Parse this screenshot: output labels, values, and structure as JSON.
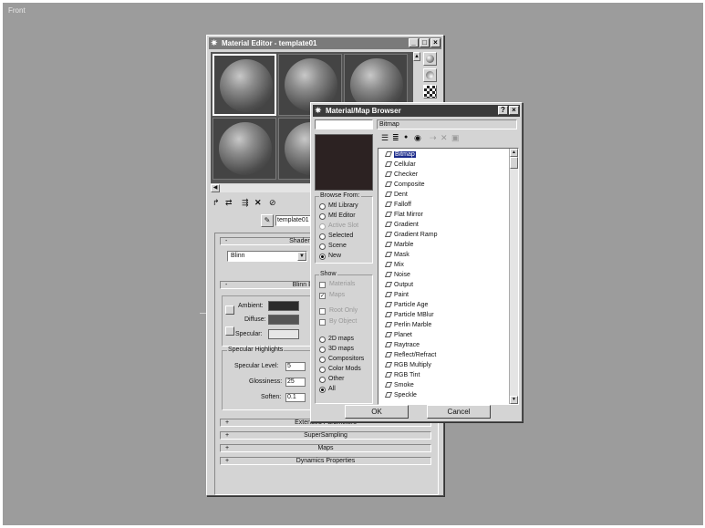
{
  "viewport": {
    "label": "Front"
  },
  "material_editor": {
    "title": "Material Editor - template01",
    "material_name": "template01",
    "shader_rollout": "Shader Basic Parameters",
    "shader_value": "Blinn",
    "blinn_rollout": "Blinn Basic Parameters",
    "ambient_label": "Ambient:",
    "diffuse_label": "Diffuse:",
    "specular_label": "Specular:",
    "highlights_title": "Specular Highlights",
    "specular_level_label": "Specular Level:",
    "specular_level": "5",
    "glossiness_label": "Glossiness:",
    "glossiness": "25",
    "soften_label": "Soften:",
    "soften": "0.1",
    "rollouts": [
      {
        "sign": "+",
        "label": "Extended Parameters"
      },
      {
        "sign": "+",
        "label": "SuperSampling"
      },
      {
        "sign": "+",
        "label": "Maps"
      },
      {
        "sign": "+",
        "label": "Dynamics Properties"
      }
    ],
    "colors": {
      "ambient": "#2b2b2b",
      "diffuse": "#555555",
      "specular": "#e6e6e6"
    }
  },
  "browser": {
    "title": "Material/Map Browser",
    "search_value": "",
    "selected_name": "Bitmap",
    "browse_from_title": "Browse From:",
    "browse_from": [
      {
        "label": "Mtl Library",
        "on": false,
        "disabled": false
      },
      {
        "label": "Mtl Editor",
        "on": false,
        "disabled": false
      },
      {
        "label": "Active Slot",
        "on": false,
        "disabled": true
      },
      {
        "label": "Selected",
        "on": false,
        "disabled": false
      },
      {
        "label": "Scene",
        "on": false,
        "disabled": false
      },
      {
        "label": "New",
        "on": true,
        "disabled": false
      }
    ],
    "show_title": "Show",
    "show": [
      {
        "label": "Materials",
        "checked": false
      },
      {
        "label": "Maps",
        "checked": true
      }
    ],
    "show2": [
      {
        "label": "Root Only",
        "checked": false
      },
      {
        "label": "By Object",
        "checked": false
      }
    ],
    "types": [
      {
        "label": "2D maps",
        "on": false
      },
      {
        "label": "3D maps",
        "on": false
      },
      {
        "label": "Compositors",
        "on": false
      },
      {
        "label": "Color Mods",
        "on": false
      },
      {
        "label": "Other",
        "on": false
      },
      {
        "label": "All",
        "on": true
      }
    ],
    "maps": [
      "Bitmap",
      "Cellular",
      "Checker",
      "Composite",
      "Dent",
      "Falloff",
      "Flat Mirror",
      "Gradient",
      "Gradient Ramp",
      "Marble",
      "Mask",
      "Mix",
      "Noise",
      "Output",
      "Paint",
      "Particle Age",
      "Particle MBlur",
      "Perlin Marble",
      "Planet",
      "Raytrace",
      "Reflect/Refract",
      "RGB Multiply",
      "RGB Tint",
      "Smoke",
      "Speckle"
    ],
    "ok_label": "OK",
    "cancel_label": "Cancel"
  }
}
